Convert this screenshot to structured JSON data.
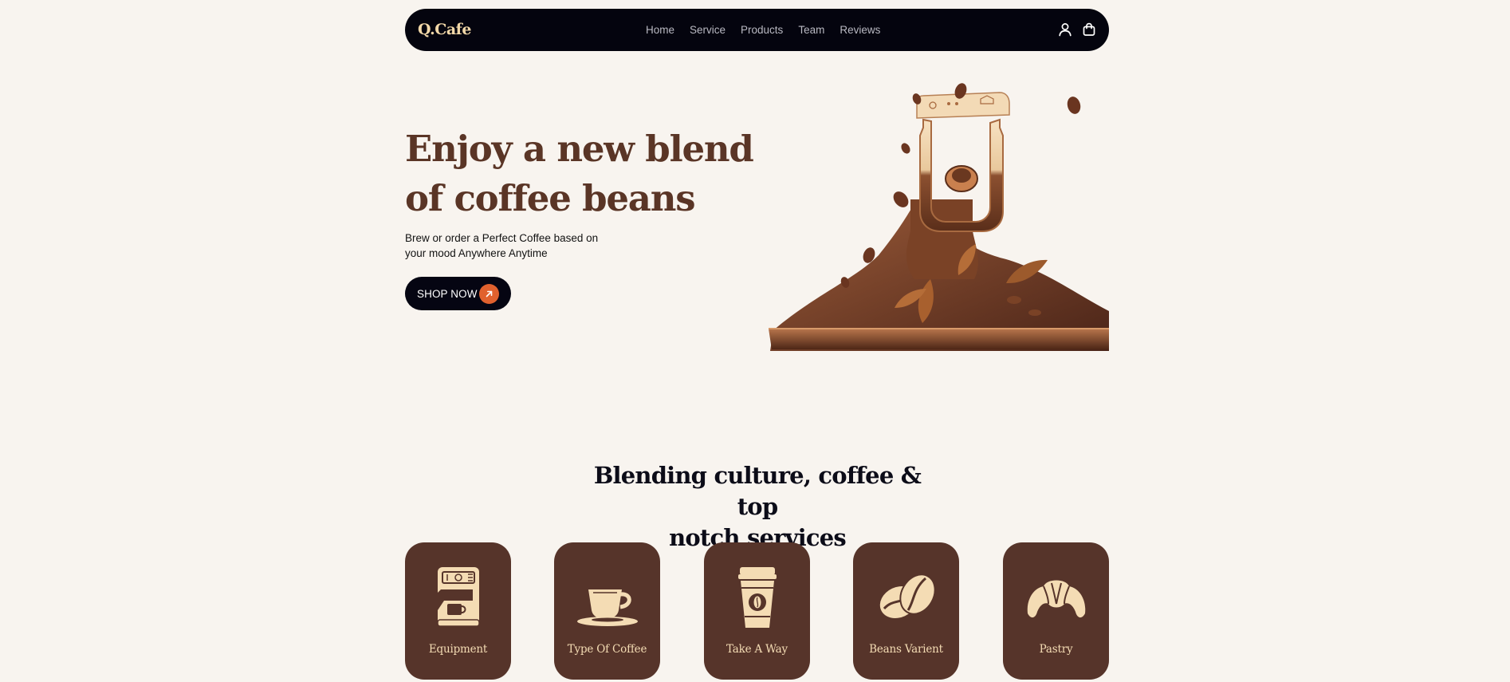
{
  "header": {
    "logo": "Q.Cafe",
    "nav": [
      "Home",
      "Service",
      "Products",
      "Team",
      "Reviews"
    ],
    "icons": [
      "user-icon",
      "shopping-bag-icon"
    ]
  },
  "hero": {
    "title_line1": "Enjoy a new blend",
    "title_line2": "of coffee beans",
    "subtitle_line1": "Brew or order a Perfect Coffee based on",
    "subtitle_line2": "your mood Anywhere Anytime",
    "cta_label": "SHOP NOW",
    "cta_icon": "arrow-up-right-icon",
    "image_icon": "coffee-grinder-illustration"
  },
  "services": {
    "title_line1": "Blending culture, coffee & top",
    "title_line2": "notch services",
    "cards": [
      {
        "label": "Equipment",
        "icon": "espresso-machine-icon"
      },
      {
        "label": "Type Of Coffee",
        "icon": "coffee-cup-icon"
      },
      {
        "label": "Take A Way",
        "icon": "takeaway-cup-icon"
      },
      {
        "label": "Beans Varient",
        "icon": "coffee-beans-icon"
      },
      {
        "label": "Pastry",
        "icon": "croissant-icon"
      }
    ]
  },
  "colors": {
    "background": "#f8f4ef",
    "navbar": "#04040e",
    "logo": "#f2d8a8",
    "hero_title": "#5a3526",
    "accent": "#e0612e",
    "card": "#56342a",
    "card_label": "#f4dcb4"
  }
}
